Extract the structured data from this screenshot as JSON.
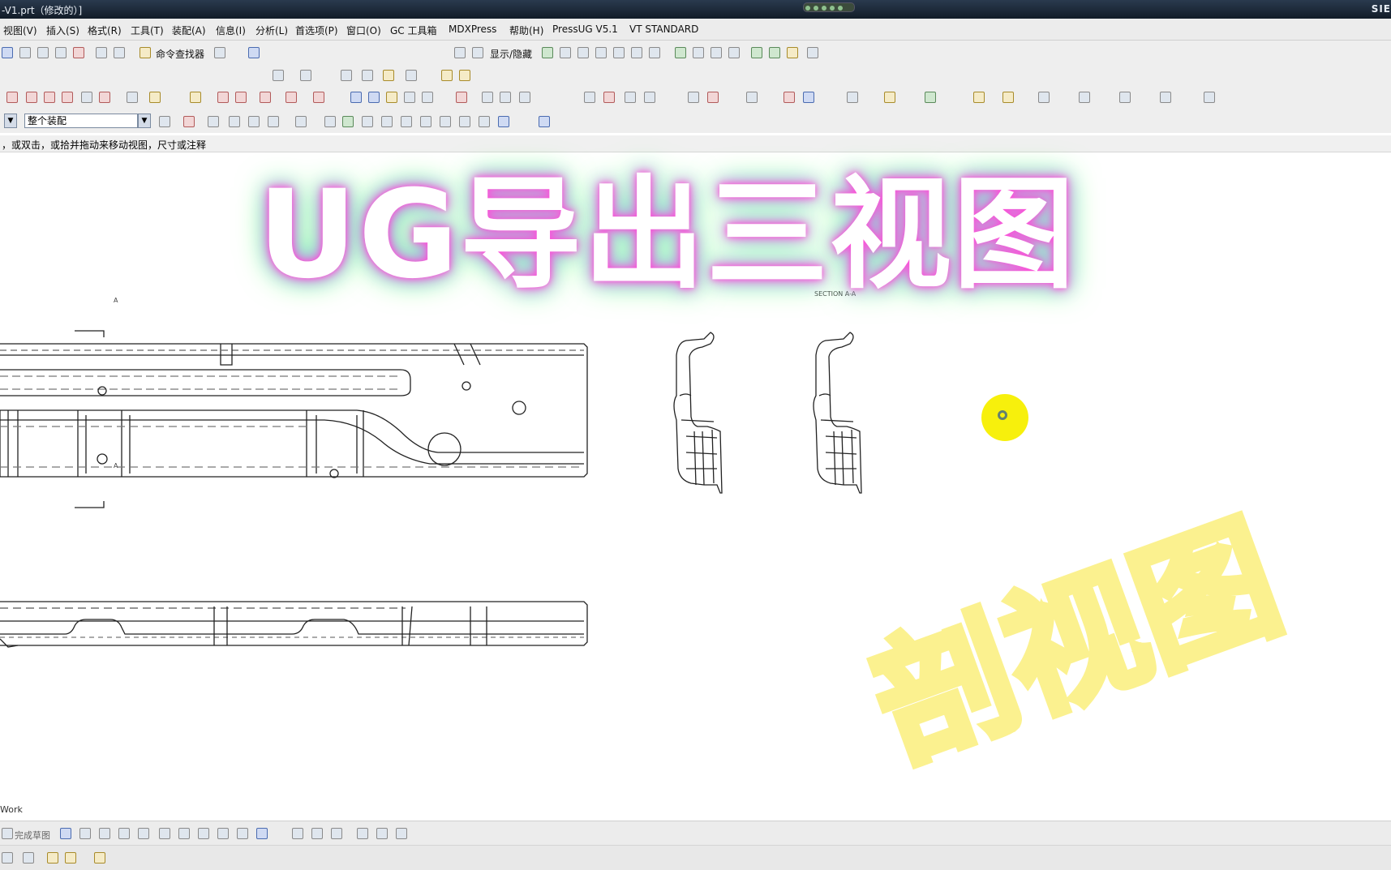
{
  "window": {
    "title": "-V1.prt（修改的）]",
    "brand": "SIE"
  },
  "menu": [
    "视图(V)",
    "插入(S)",
    "格式(R)",
    "工具(T)",
    "装配(A)",
    "信息(I)",
    "分析(L)",
    "首选项(P)",
    "窗口(O)",
    "GC 工具箱",
    "MDXPress",
    "帮助(H)",
    "PressUG V5.1",
    "VT STANDARD"
  ],
  "toolbar": {
    "command_finder": "命令查找器",
    "show_hide_label": "显示/隐藏",
    "selection_filter": "整个装配",
    "selection_filter_dropdown_icon": "chevron-down-icon"
  },
  "cue_line": "，或双击，或拾并拖动来移动视图，尺寸或注释",
  "drawing": {
    "section_label": "SECTION A-A",
    "section_marker": "A"
  },
  "overlay": {
    "title": "UG导出三视图",
    "subtitle": "剖视图"
  },
  "status": {
    "work": "Work",
    "finish_sketch": "完成草图"
  },
  "colors": {
    "titlebar": "#1e2a38",
    "highlight": "#f7f000",
    "subtitle_stroke": "#fbef7c"
  }
}
